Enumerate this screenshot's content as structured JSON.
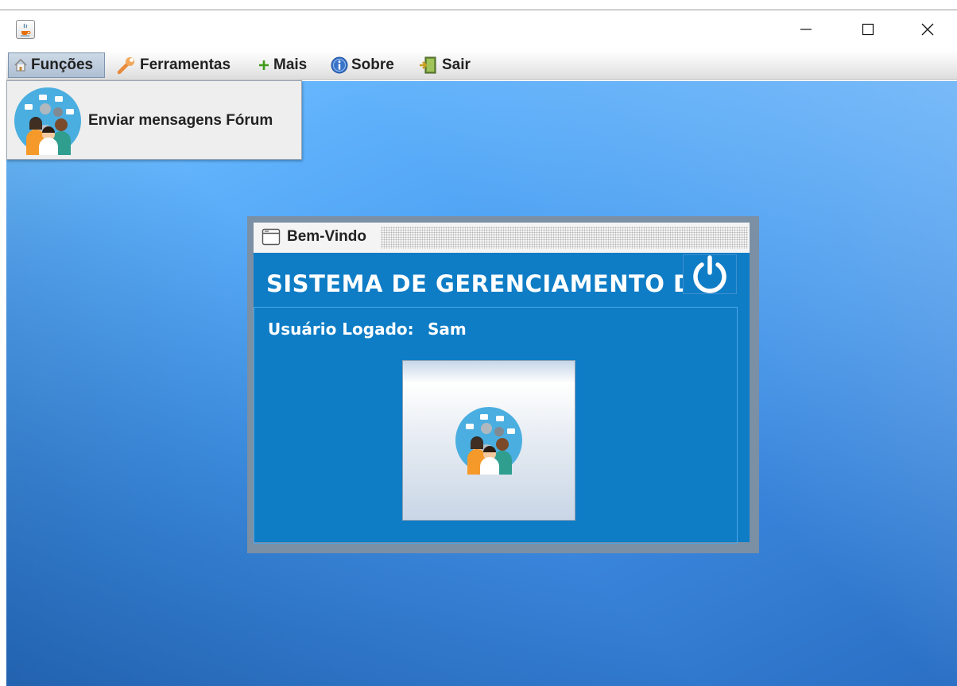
{
  "background_window": {
    "title_fragment": ""
  },
  "window": {
    "icon": "java-coffee-icon",
    "controls": {
      "minimize": "minimize-icon",
      "maximize": "maximize-icon",
      "close": "close-icon"
    }
  },
  "menubar": {
    "items": [
      {
        "label": "Funções",
        "icon": "home-icon",
        "active": true
      },
      {
        "label": "Ferramentas",
        "icon": "wrench-icon"
      },
      {
        "label": "Mais",
        "icon": "plus-icon"
      },
      {
        "label": "Sobre",
        "icon": "info-icon"
      },
      {
        "label": "Sair",
        "icon": "exit-door-icon"
      }
    ]
  },
  "dropdown": {
    "items": [
      {
        "label": "Enviar mensagens Fórum",
        "icon": "forum-people-icon"
      }
    ]
  },
  "internal_frame": {
    "title": "Bem-Vindo",
    "heading": "SISTEMA DE GERENCIAMENTO DE:",
    "user_label": "Usuário Logado:",
    "user_name": "Sam",
    "power_icon": "power-icon",
    "avatar_icon": "forum-people-icon"
  },
  "colors": {
    "frame_body": "#0e7dc6",
    "frame_border": "#7b8fa5",
    "desktop_light": "#79c8ff",
    "desktop_dark": "#2a6fc4",
    "menu_active": "#aebfd3"
  }
}
